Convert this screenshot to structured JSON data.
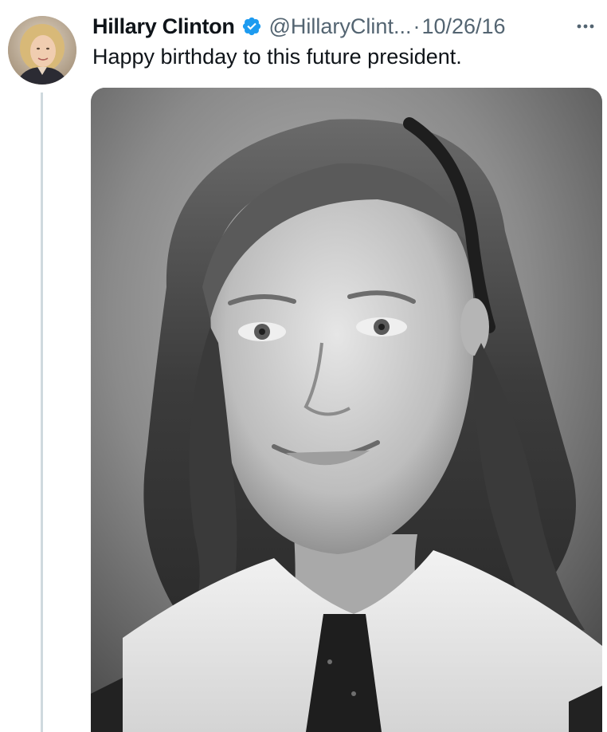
{
  "tweet": {
    "author_name": "Hillary Clinton",
    "handle": "@HillaryClint...",
    "separator": "·",
    "date": "10/26/16",
    "text": "Happy birthday to this future president.",
    "avatar_icon": "profile-photo",
    "verified_icon": "verified-badge-icon",
    "more_icon": "more-options-icon",
    "media_type": "black-and-white portrait photo"
  },
  "colors": {
    "verified_blue": "#1d9bf0",
    "text_primary": "#0f1419",
    "text_secondary": "#536471",
    "thread_line": "#cfd9de"
  }
}
